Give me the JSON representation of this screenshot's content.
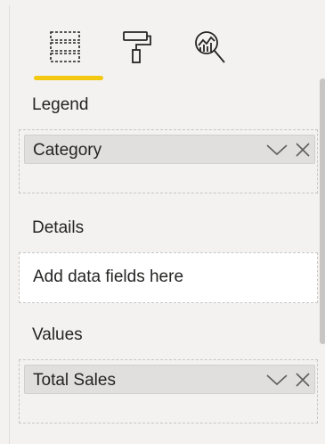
{
  "tabs": [
    {
      "name": "fields",
      "icon": "fields-icon",
      "active": true
    },
    {
      "name": "format",
      "icon": "paint-roller-icon",
      "active": false
    },
    {
      "name": "analytics",
      "icon": "analytics-magnifier-icon",
      "active": false
    }
  ],
  "accent_color": "#f2c811",
  "sections": {
    "legend": {
      "label": "Legend",
      "field": "Category"
    },
    "details": {
      "label": "Details",
      "placeholder": "Add data fields here"
    },
    "values": {
      "label": "Values",
      "field": "Total Sales"
    }
  }
}
